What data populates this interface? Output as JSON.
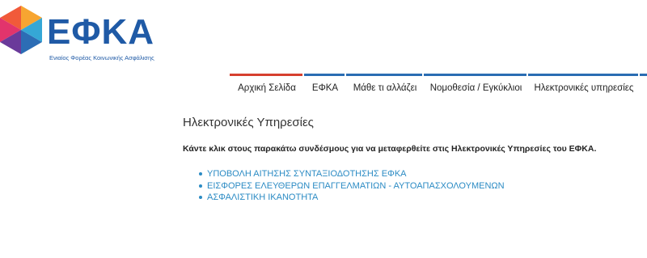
{
  "logo": {
    "wordmark": "ΕΦΚΑ",
    "tagline": "Ενιαίος Φορέας Κοινωνικής Ασφάλισης",
    "colors": [
      "#f7a531",
      "#e2346c",
      "#6a3a9a",
      "#2c6db5",
      "#35a7d6"
    ]
  },
  "nav": {
    "items": [
      {
        "label": "Αρχική Σελίδα",
        "active": true
      },
      {
        "label": "ΕΦΚΑ"
      },
      {
        "label": "Μάθε τι αλλάζει"
      },
      {
        "label": "Νομοθεσία / Εγκύκλιοι"
      },
      {
        "label": "Ηλεκτρονικές υπηρεσίες"
      }
    ],
    "accent": "#2a6db3",
    "active_accent": "#d6402f"
  },
  "main": {
    "title": "Ηλεκτρονικές Υπηρεσίες",
    "intro": "Κάντε κλικ στους παρακάτω συνδέσμους για να μεταφερθείτε στις Ηλεκτρονικές Υπηρεσίες του ΕΦΚΑ.",
    "links": [
      "ΥΠΟΒΟΛΗ ΑΙΤΗΣΗΣ ΣΥΝΤΑΞΙΟΔΟΤΗΣΗΣ ΕΦΚΑ",
      "ΕΙΣΦΟΡΕΣ ΕΛΕΥΘΕΡΩΝ ΕΠΑΓΓΕΛΜΑΤΙΩΝ - ΑΥΤΟΑΠΑΣΧΟΛΟΥΜΕΝΩΝ",
      "ΑΣΦΑΛΙΣΤΙΚΗ ΙΚΑΝΟΤΗΤΑ"
    ],
    "link_color": "#2b8bc4"
  }
}
